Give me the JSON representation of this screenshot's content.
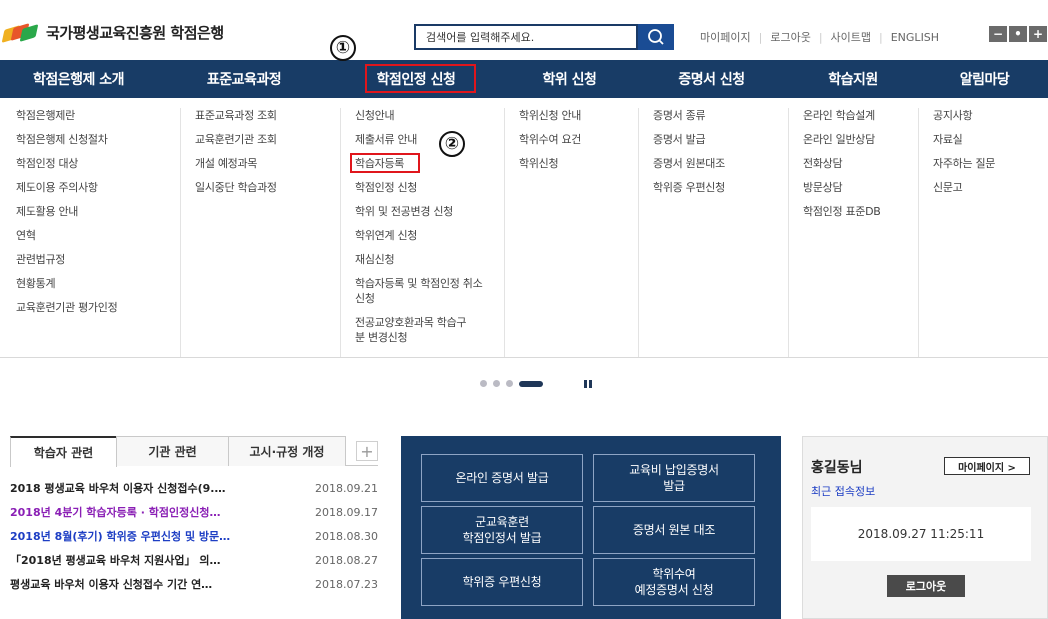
{
  "header": {
    "logo_text": "국가평생교육진흥원 학점은행",
    "search_placeholder": "검색어를 입력해주세요.",
    "top_links": [
      "마이페이지",
      "로그아웃",
      "사이트맵",
      "ENGLISH"
    ],
    "font_controls": [
      "−",
      "•",
      "+"
    ]
  },
  "nav": {
    "items": [
      "학점은행제 소개",
      "표준교육과정",
      "학점인정 신청",
      "학위 신청",
      "증명서 신청",
      "학습지원",
      "알림마당"
    ]
  },
  "mega_menu": {
    "columns": [
      [
        "학점은행제란",
        "학점은행제 신청절차",
        "학점인정 대상",
        "제도이용 주의사항",
        "제도활용 안내",
        "연혁",
        "관련법규정",
        "현황통계",
        "교육훈련기관 평가인정"
      ],
      [
        "표준교육과정 조회",
        "교육훈련기관 조회",
        "개설 예정과목",
        "일시중단 학습과정"
      ],
      [
        "신청안내",
        "제출서류 안내",
        "학습자등록",
        "학점인정 신청",
        "학위 및 전공변경 신청",
        "학위연계 신청",
        "재심신청",
        "학습자등록 및 학점인정 취소 신청",
        "전공교양호환과목 학습구분 변경신청"
      ],
      [
        "학위신청 안내",
        "학위수여 요건",
        "학위신청"
      ],
      [
        "증명서 종류",
        "증명서 발급",
        "증명서 원본대조",
        "학위증 우편신청"
      ],
      [
        "온라인 학습설계",
        "온라인 일반상담",
        "전화상담",
        "방문상담",
        "학점인정 표준DB"
      ],
      [
        "공지사항",
        "자료실",
        "자주하는 질문",
        "신문고"
      ]
    ]
  },
  "annotations": [
    "①",
    "②"
  ],
  "notice": {
    "tabs": [
      "학습자 관련",
      "기관 관련",
      "고시·규정 개정"
    ],
    "plus": "+",
    "rows": [
      {
        "title": "2018 평생교육 바우처 이용자 신청접수(9.…",
        "date": "2018.09.21"
      },
      {
        "title": "2018년 4분기 학습자등록 · 학점인정신청…",
        "date": "2018.09.17"
      },
      {
        "title": "2018년 8월(후기) 학위증 우편신청 및 방문…",
        "date": "2018.08.30"
      },
      {
        "title": "「2018년 평생교육 바우처 지원사업」 의…",
        "date": "2018.08.27"
      },
      {
        "title": "평생교육 바우처 이용자 신청접수 기간 연…",
        "date": "2018.07.23"
      }
    ]
  },
  "quick": {
    "buttons": [
      "온라인 증명서 발급",
      "교육비 납입증명서\n발급",
      "군교육훈련\n학점인정서 발급",
      "증명서 원본 대조",
      "학위증 우편신청",
      "학위수여\n예정증명서 신청"
    ]
  },
  "login": {
    "user_name": "홍길동님",
    "mypage_label": "마이페이지 >",
    "recent_label": "최근 접속정보",
    "recent_time": "2018.09.27 11:25:11",
    "logout_label": "로그아웃"
  },
  "colors": {
    "nav_bg": "#183c66",
    "highlight": "#e0161c",
    "search_btn": "#1a4c94"
  }
}
